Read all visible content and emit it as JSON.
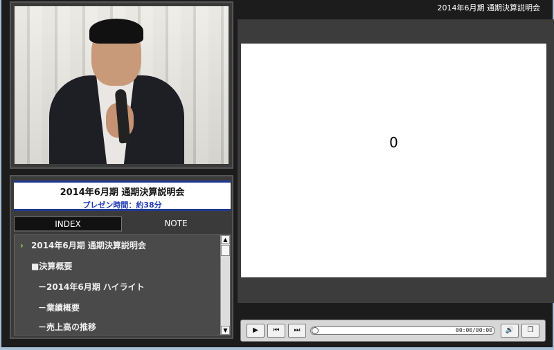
{
  "header": {
    "title": "2014年6月期 通期決算説明会"
  },
  "info": {
    "title": "2014年6月期  通期決算説明会",
    "subtitle": "プレゼン時間：約38分"
  },
  "tabs": [
    {
      "label": "INDEX"
    },
    {
      "label": "NOTE"
    }
  ],
  "index_items": [
    {
      "label": "2014年6月期 通期決算説明会"
    },
    {
      "label": "■決算概要"
    },
    {
      "label": "－2014年6月期 ハイライト"
    },
    {
      "label": "－業績概要"
    },
    {
      "label": "－売上高の推移"
    }
  ],
  "slide": {
    "page": "0"
  },
  "player": {
    "time": "00:00/00:00",
    "progress": 0
  },
  "icons": {
    "play": "play-icon",
    "prev": "skip-back-icon",
    "next": "skip-forward-icon",
    "volume": "volume-icon",
    "window": "window-icon"
  },
  "colors": {
    "accent": "#1f3ab5",
    "chevron": "#8ed14b"
  }
}
